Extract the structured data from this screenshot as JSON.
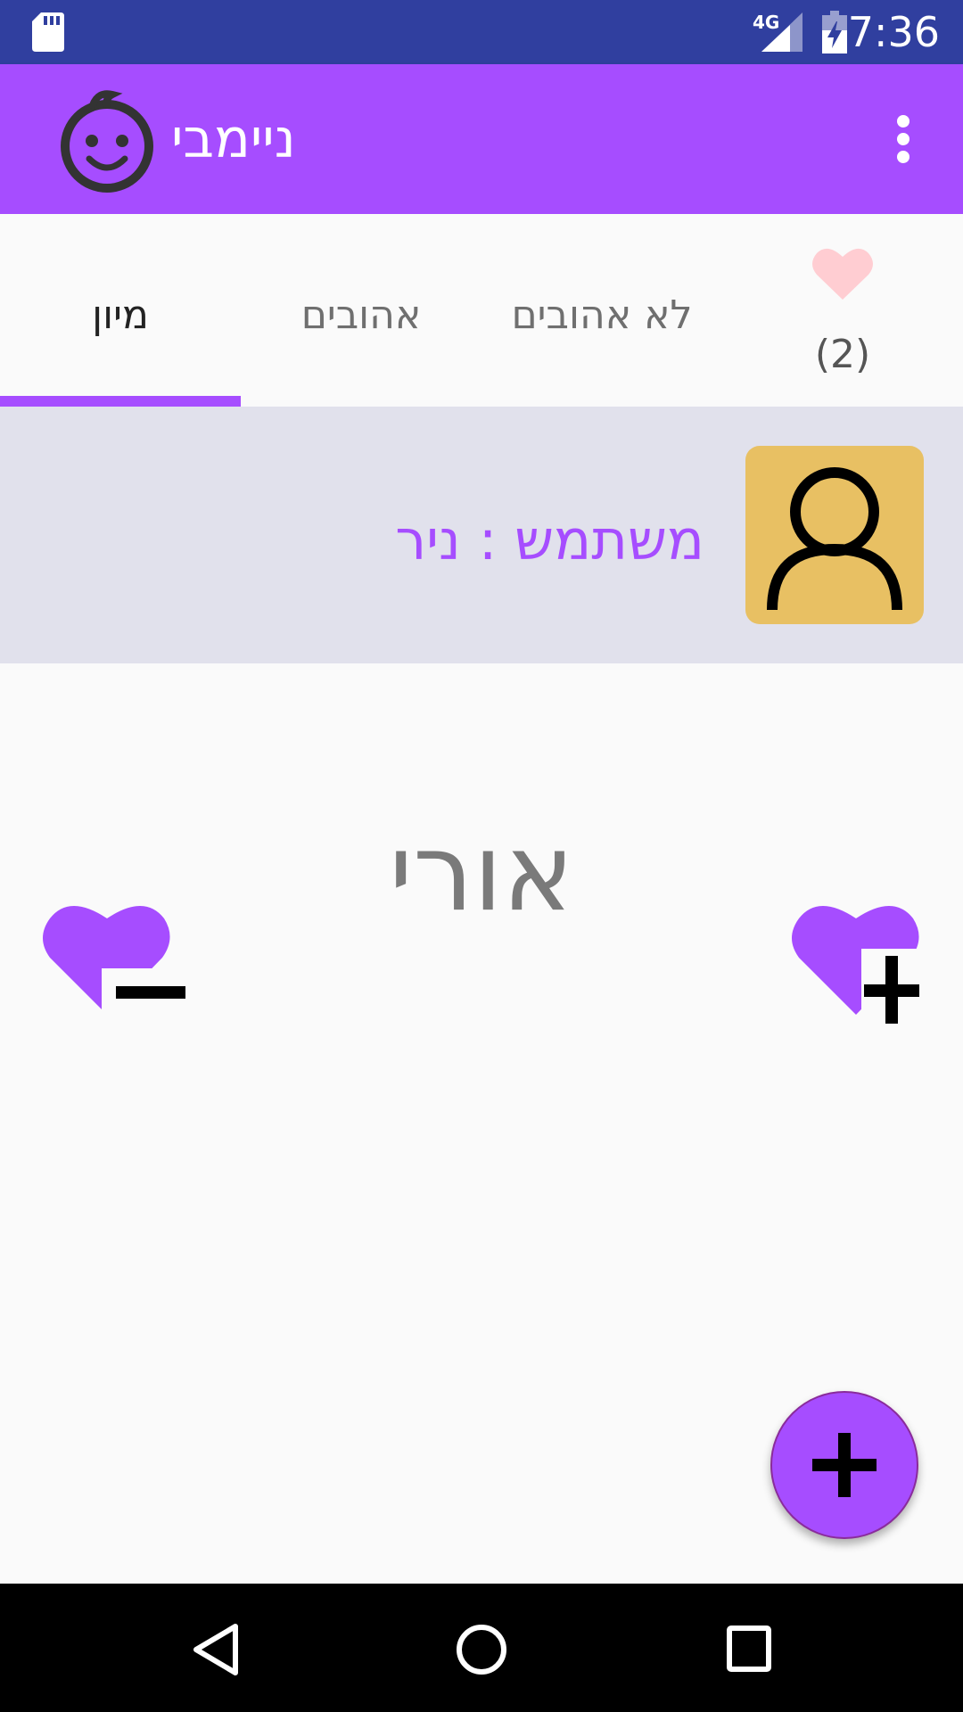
{
  "status_bar": {
    "time": "7:36",
    "network": "4G",
    "icons": [
      "sd-card-icon",
      "signal-icon",
      "battery-charging-icon"
    ]
  },
  "app_bar": {
    "title": "ניימבי",
    "logo_icon": "baby-face-icon",
    "menu_icon": "more-vert-icon"
  },
  "tabs": [
    {
      "label": "מיון",
      "selected": true
    },
    {
      "label": "אהובים",
      "selected": false
    },
    {
      "label": "לא אהובים",
      "selected": false
    }
  ],
  "favorites": {
    "icon": "heart-icon",
    "count_text": "(2)"
  },
  "user": {
    "label": "משתמש : ניר",
    "avatar_icon": "person-icon"
  },
  "current_name": "אורי",
  "actions": {
    "dislike_icon": "heart-minus-icon",
    "like_icon": "heart-plus-icon",
    "fab_icon": "plus-icon"
  },
  "nav_bar": {
    "back_icon": "back-icon",
    "home_icon": "home-icon",
    "recents_icon": "recents-icon"
  },
  "colors": {
    "status_bar": "#303f9f",
    "primary": "#a64dff",
    "card_bg": "#e1e1ec",
    "avatar_bg": "#e8c063",
    "heart_pink": "#ffcdd2",
    "text_gray": "#7a7a7a"
  }
}
